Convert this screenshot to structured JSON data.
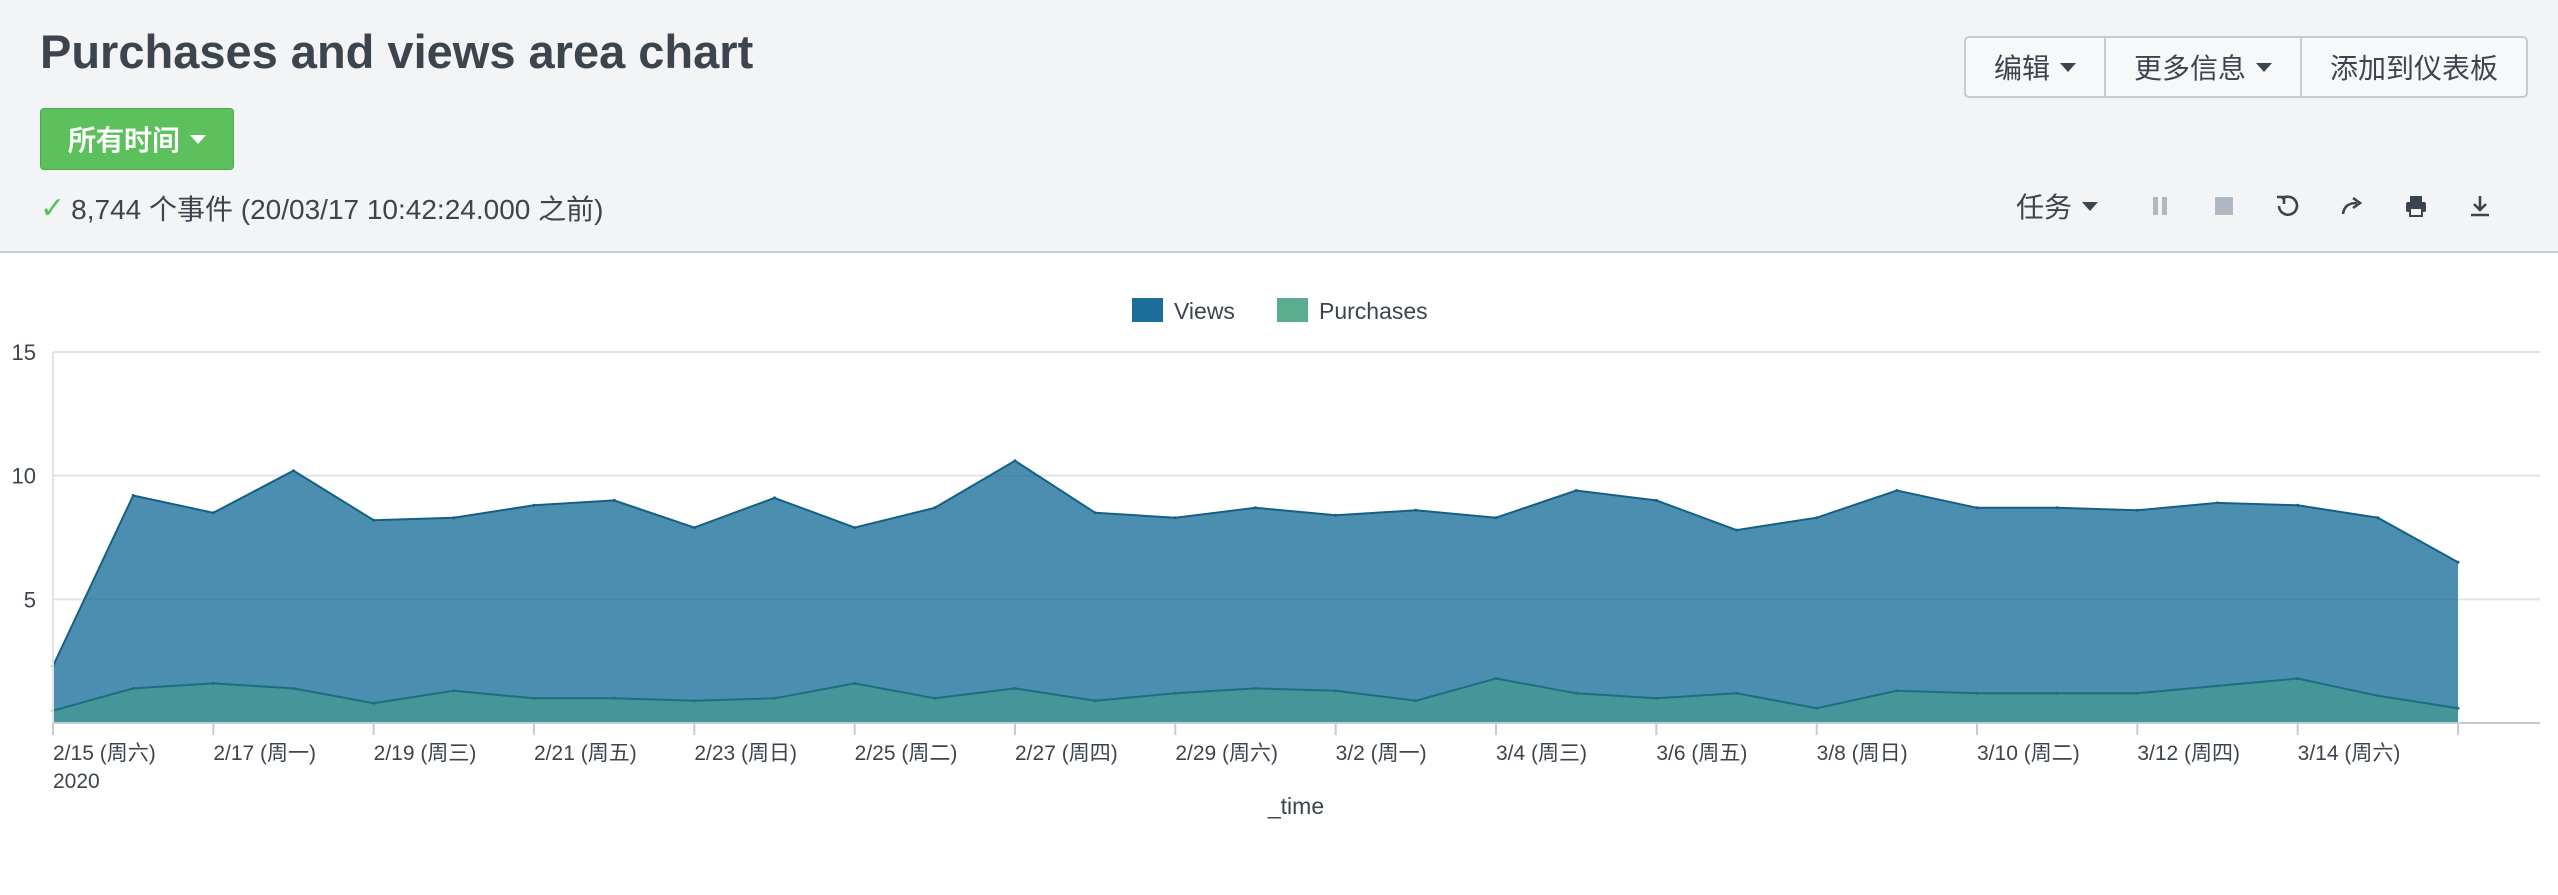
{
  "page": {
    "title": "Purchases and views area chart",
    "time_picker_label": "所有时间",
    "status_text": "8,744 个事件 (20/03/17 10:42:24.000 之前)"
  },
  "actions": {
    "edit_label": "编辑",
    "more_info_label": "更多信息",
    "add_dashboard_label": "添加到仪表板"
  },
  "job": {
    "job_label": "任务",
    "icons": [
      "pause-icon",
      "stop-icon",
      "refresh-icon",
      "share-icon",
      "print-icon",
      "export-icon"
    ]
  },
  "colors": {
    "views": "#1a6e99",
    "purchases": "#3e9f7d",
    "time_button": "#5cc05c"
  },
  "chart_data": {
    "type": "area",
    "ylim": [
      0,
      15
    ],
    "yticks": [
      5,
      10,
      15
    ],
    "xlabel": "_time",
    "ylabel": "",
    "legend": "top-center",
    "grid": true,
    "x": [
      "2/15",
      "2/16",
      "2/17",
      "2/18",
      "2/19",
      "2/20",
      "2/21",
      "2/22",
      "2/23",
      "2/24",
      "2/25",
      "2/26",
      "2/27",
      "2/28",
      "2/29",
      "3/1",
      "3/2",
      "3/3",
      "3/4",
      "3/5",
      "3/6",
      "3/7",
      "3/8",
      "3/9",
      "3/10",
      "3/11",
      "3/12",
      "3/13",
      "3/14",
      "3/15",
      "3/16"
    ],
    "xtick_labels": [
      "2/15 (周六)",
      "2/17 (周一)",
      "2/19 (周三)",
      "2/21 (周五)",
      "2/23 (周日)",
      "2/25 (周二)",
      "2/27 (周四)",
      "2/29 (周六)",
      "3/2 (周一)",
      "3/4 (周三)",
      "3/6 (周五)",
      "3/8 (周日)",
      "3/10 (周二)",
      "3/12 (周四)",
      "3/14 (周六)"
    ],
    "xtick_year": "2020",
    "series": [
      {
        "name": "Views",
        "values": [
          2.3,
          9.2,
          8.5,
          10.2,
          8.2,
          8.3,
          8.8,
          9.0,
          7.9,
          9.1,
          7.9,
          8.7,
          10.6,
          8.5,
          8.3,
          8.7,
          8.4,
          8.6,
          8.3,
          9.4,
          9.0,
          7.8,
          8.3,
          9.4,
          8.7,
          8.7,
          8.6,
          8.9,
          8.8,
          8.3,
          6.5
        ]
      },
      {
        "name": "Purchases",
        "values": [
          0.5,
          1.4,
          1.6,
          1.4,
          0.8,
          1.3,
          1.0,
          1.0,
          0.9,
          1.0,
          1.6,
          1.0,
          1.4,
          0.9,
          1.2,
          1.4,
          1.3,
          0.9,
          1.8,
          1.2,
          1.0,
          1.2,
          0.6,
          1.3,
          1.2,
          1.2,
          1.2,
          1.5,
          1.8,
          1.1,
          0.6
        ]
      }
    ]
  }
}
